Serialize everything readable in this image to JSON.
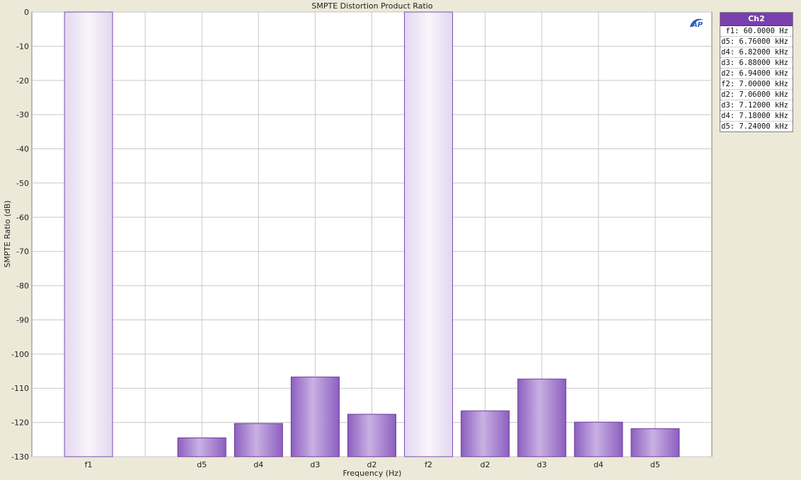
{
  "chart_data": {
    "type": "bar",
    "title": "SMPTE Distortion Product Ratio",
    "xlabel": "Frequency (Hz)",
    "ylabel": "SMPTE Ratio (dB)",
    "ylim": [
      -130,
      0
    ],
    "yticks": [
      0,
      -10,
      -20,
      -30,
      -40,
      -50,
      -60,
      -70,
      -80,
      -90,
      -100,
      -110,
      -120,
      -130
    ],
    "grid": true,
    "categories": [
      "f1",
      "",
      "d5",
      "d4",
      "d3",
      "d2",
      "f2",
      "d2",
      "d3",
      "d4",
      "d5"
    ],
    "series": [
      {
        "values": [
          0,
          null,
          -124.5,
          -120.3,
          -106.7,
          -117.6,
          0,
          -116.6,
          -107.3,
          -119.9,
          -121.8
        ]
      }
    ],
    "legend": {
      "header": "Ch2",
      "entries": [
        "f1: 60.0000 Hz",
        "d5: 6.76000 kHz",
        "d4: 6.82000 kHz",
        "d3: 6.88000 kHz",
        "d2: 6.94000 kHz",
        "f2: 7.00000 kHz",
        "d2: 7.06000 kHz",
        "d3: 7.12000 kHz",
        "d4: 7.18000 kHz",
        "d5: 7.24000 kHz"
      ],
      "placement": "right"
    },
    "colors": {
      "bar_fill": "#a67fd0",
      "bar_stroke": "#6a3a9a",
      "reference_fill": "#ede6f5",
      "reference_stroke": "#7a4ab0",
      "legend_header": "#7a3fae"
    }
  },
  "logo": {
    "icon": "ap-logo-icon",
    "text": "AP"
  }
}
